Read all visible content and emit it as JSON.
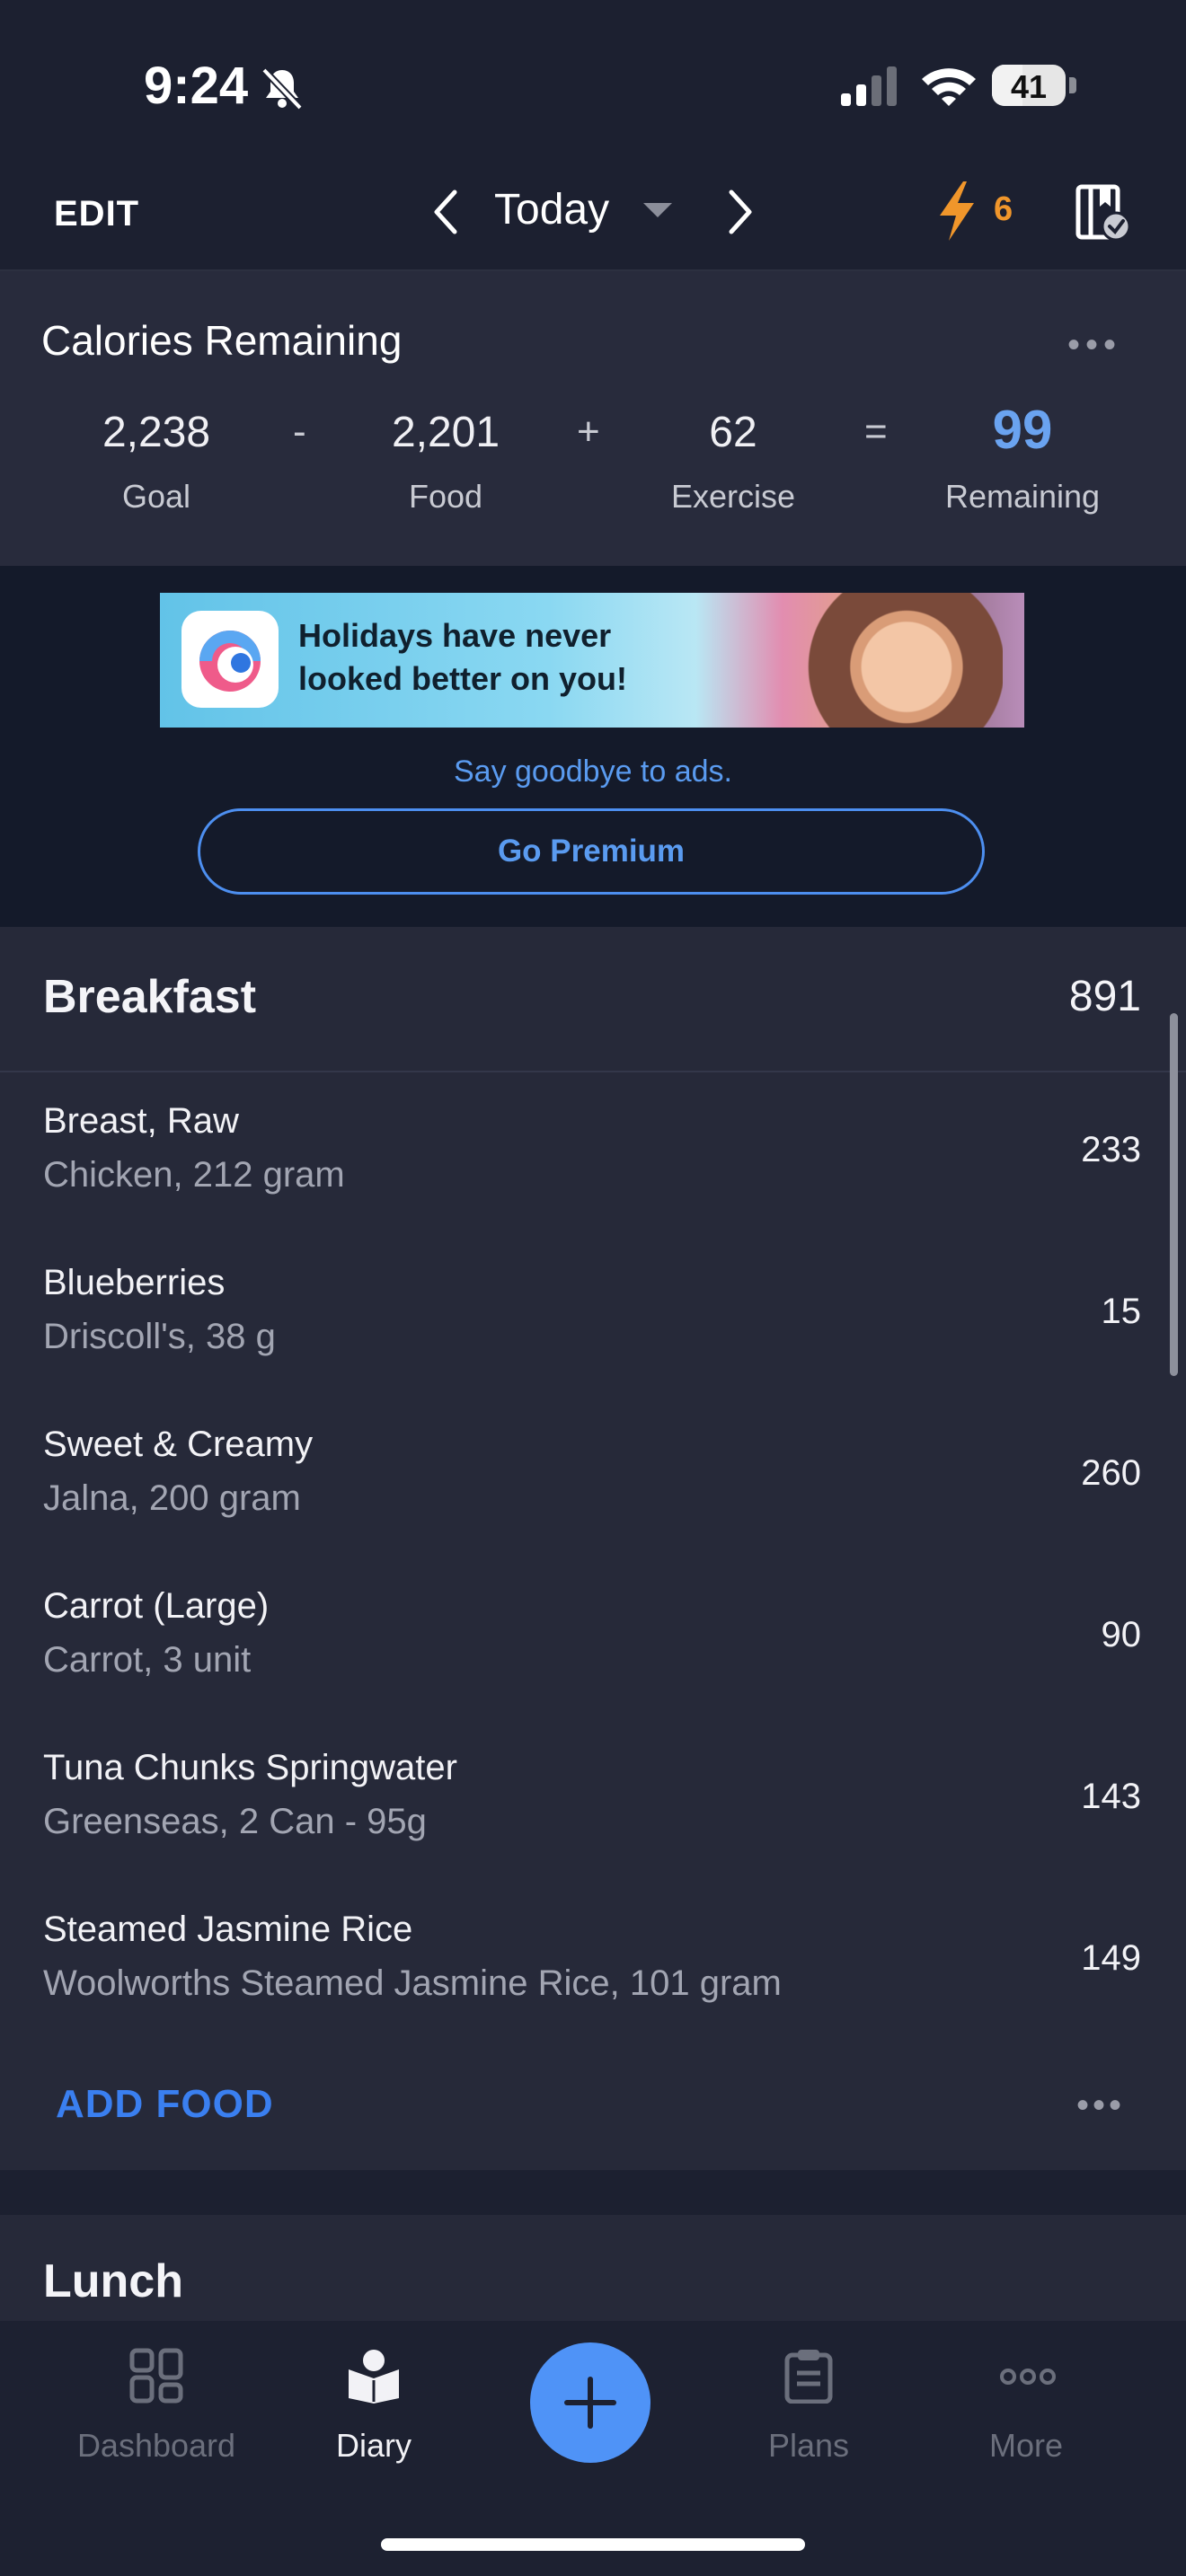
{
  "status_bar": {
    "time": "9:24",
    "battery": "41",
    "battery_level": 0.41
  },
  "nav": {
    "edit": "EDIT",
    "date": "Today",
    "streak": "6"
  },
  "calories": {
    "title": "Calories Remaining",
    "goal": "2,238",
    "goal_label": "Goal",
    "minus": "-",
    "food": "2,201",
    "food_label": "Food",
    "plus": "+",
    "exercise": "62",
    "exercise_label": "Exercise",
    "equals": "=",
    "remaining": "99",
    "remaining_label": "Remaining"
  },
  "ad": {
    "banner_text": "Holidays have never looked better on you!",
    "caption": "Say goodbye to ads.",
    "premium": "Go Premium"
  },
  "breakfast": {
    "title": "Breakfast",
    "total": "891",
    "items": [
      {
        "name": "Breast, Raw",
        "desc": "Chicken, 212 gram",
        "cal": "233"
      },
      {
        "name": "Blueberries",
        "desc": "Driscoll's, 38 g",
        "cal": "15"
      },
      {
        "name": "Sweet & Creamy",
        "desc": "Jalna, 200 gram",
        "cal": "260"
      },
      {
        "name": "Carrot (Large)",
        "desc": "Carrot, 3 unit",
        "cal": "90"
      },
      {
        "name": "Tuna Chunks Springwater",
        "desc": "Greenseas, 2 Can - 95g",
        "cal": "143"
      },
      {
        "name": "Steamed Jasmine Rice",
        "desc": "Woolworths Steamed Jasmine Rice, 101 gram",
        "cal": "149"
      }
    ],
    "add_food": "ADD FOOD"
  },
  "lunch": {
    "title": "Lunch"
  },
  "tabs": {
    "dashboard": "Dashboard",
    "diary": "Diary",
    "plans": "Plans",
    "more": "More"
  },
  "colors": {
    "accent": "#4f93f7",
    "remaining": "#6aa3f0",
    "streak": "#f0962b"
  }
}
